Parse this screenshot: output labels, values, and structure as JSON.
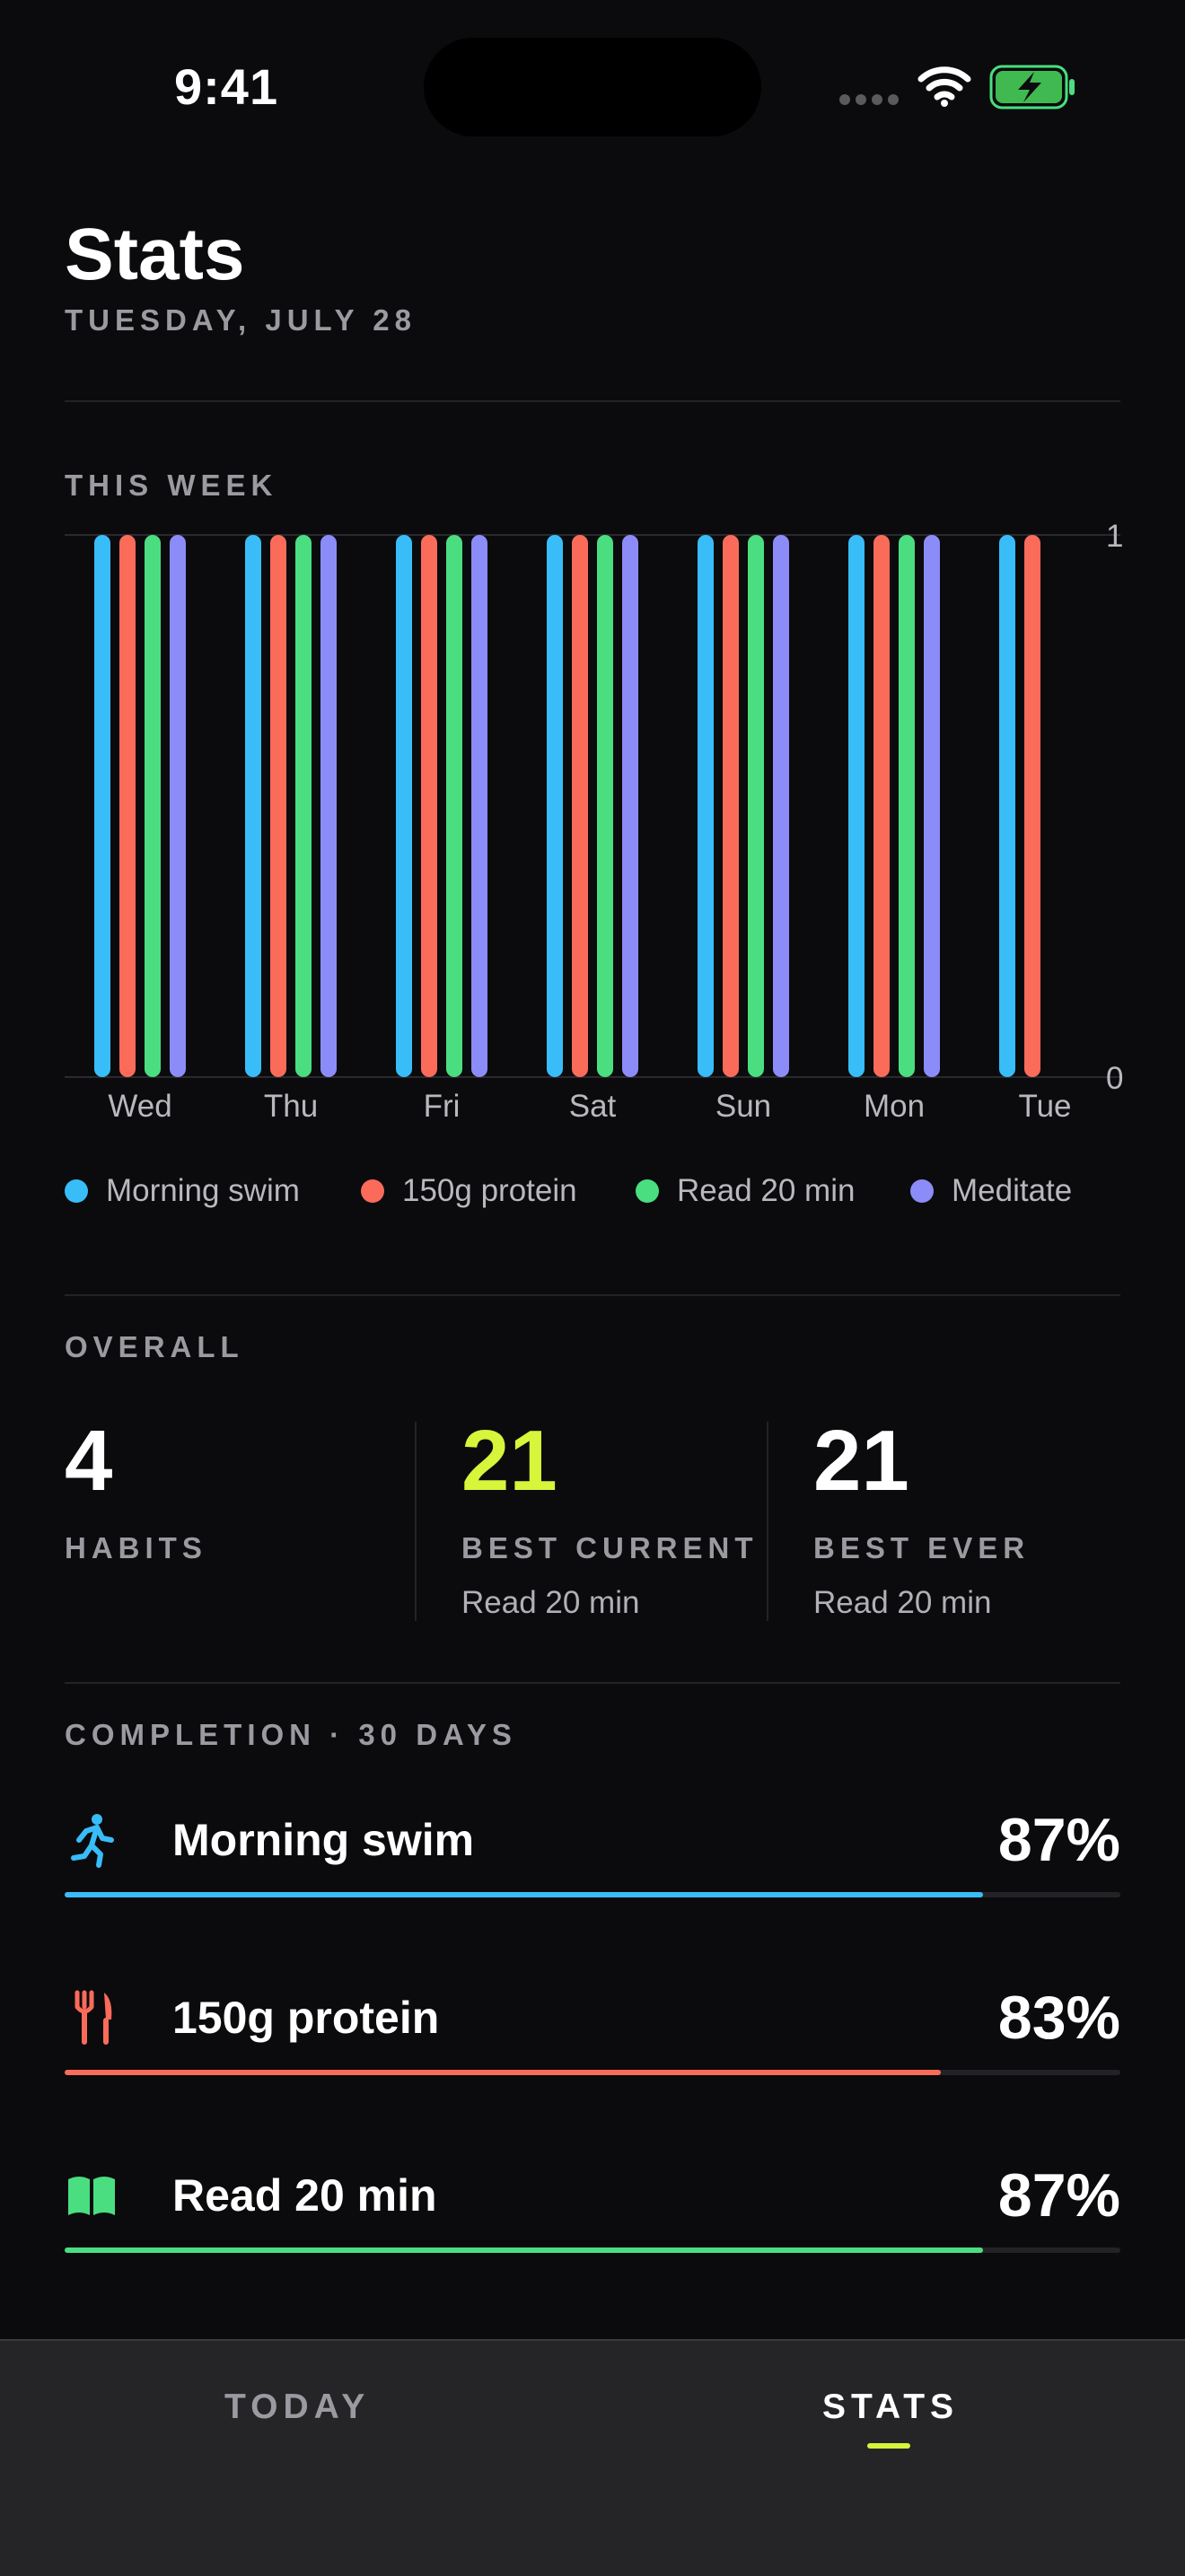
{
  "status_bar": {
    "time": "9:41"
  },
  "header": {
    "title": "Stats",
    "date": "TUESDAY, JULY 28"
  },
  "week_section": {
    "label": "THIS WEEK"
  },
  "chart_data": {
    "type": "bar",
    "categories": [
      "Wed",
      "Thu",
      "Fri",
      "Sat",
      "Sun",
      "Mon",
      "Tue"
    ],
    "series": [
      {
        "name": "Morning swim",
        "color": "#38bdf8",
        "values": [
          1,
          1,
          1,
          1,
          1,
          1,
          1
        ]
      },
      {
        "name": "150g protein",
        "color": "#fb6b5a",
        "values": [
          1,
          1,
          1,
          1,
          1,
          1,
          1
        ]
      },
      {
        "name": "Read 20 min",
        "color": "#4ade80",
        "values": [
          1,
          1,
          1,
          1,
          1,
          1,
          0
        ]
      },
      {
        "name": "Meditate",
        "color": "#8b8cf8",
        "values": [
          1,
          1,
          1,
          1,
          1,
          1,
          0
        ]
      }
    ],
    "yticks": [
      "1",
      "0"
    ],
    "ylim": [
      0,
      1
    ],
    "grid": true,
    "legend": "bottom"
  },
  "overall": {
    "label": "OVERALL",
    "habits": {
      "value": "4",
      "label": "HABITS"
    },
    "best_current": {
      "value": "21",
      "label": "BEST CURRENT",
      "sub": "Read 20 min",
      "color": "#d7f53a"
    },
    "best_ever": {
      "value": "21",
      "label": "BEST EVER",
      "sub": "Read 20 min"
    }
  },
  "completion": {
    "label": "COMPLETION · 30 DAYS",
    "items": [
      {
        "name": "Morning swim",
        "pct": "87%",
        "fraction": 0.87,
        "color": "#38bdf8",
        "icon": "running-icon"
      },
      {
        "name": "150g protein",
        "pct": "83%",
        "fraction": 0.83,
        "color": "#fb6b5a",
        "icon": "fork-knife-icon"
      },
      {
        "name": "Read 20 min",
        "pct": "87%",
        "fraction": 0.87,
        "color": "#4ade80",
        "icon": "book-icon"
      }
    ]
  },
  "tabbar": {
    "today": "TODAY",
    "stats": "STATS",
    "active": "stats",
    "accent": "#d7f53a"
  }
}
